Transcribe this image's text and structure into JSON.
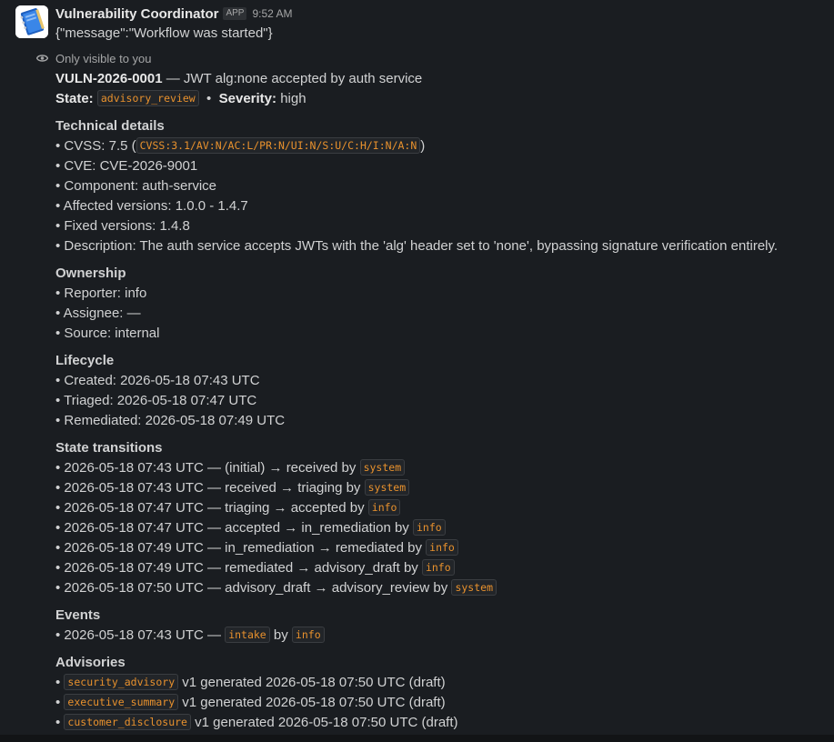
{
  "app": {
    "name": "Vulnerability Coordinator",
    "badge": "APP",
    "time": "9:52 AM"
  },
  "message_text": "{\"message\":\"Workflow was started\"}",
  "visibility": "Only visible to you",
  "vuln": {
    "id": "VULN-2026-0001",
    "title": " — JWT alg:none accepted by auth service",
    "state_label": "State:",
    "state": "advisory_review",
    "severity_label": "Severity:",
    "severity": "high"
  },
  "technical": {
    "heading": "Technical details",
    "cvss_prefix": "• CVSS: 7.5 (",
    "cvss_vector": "CVSS:3.1/AV:N/AC:L/PR:N/UI:N/S:U/C:H/I:N/A:N",
    "cvss_suffix": ")",
    "cve": "• CVE: CVE-2026-9001",
    "component": "• Component: auth-service",
    "affected": "• Affected versions: 1.0.0 - 1.4.7",
    "fixed": "• Fixed versions: 1.4.8",
    "description": "• Description: The auth service accepts JWTs with the 'alg' header set to 'none', bypassing signature verification entirely."
  },
  "ownership": {
    "heading": "Ownership",
    "reporter": "• Reporter: info",
    "assignee": "• Assignee: —",
    "source": "• Source: internal"
  },
  "lifecycle": {
    "heading": "Lifecycle",
    "created": "• Created: 2026-05-18 07:43 UTC",
    "triaged": "• Triaged: 2026-05-18 07:47 UTC",
    "remediated": "• Remediated: 2026-05-18 07:49 UTC"
  },
  "transitions": {
    "heading": "State transitions",
    "items": [
      {
        "text": "• 2026-05-18 07:43 UTC — (initial) → received by ",
        "actor": "system"
      },
      {
        "text": "• 2026-05-18 07:43 UTC — received → triaging by ",
        "actor": "system"
      },
      {
        "text": "• 2026-05-18 07:47 UTC — triaging → accepted by ",
        "actor": "info"
      },
      {
        "text": "• 2026-05-18 07:47 UTC — accepted → in_remediation by ",
        "actor": "info"
      },
      {
        "text": "• 2026-05-18 07:49 UTC — in_remediation → remediated by ",
        "actor": "info"
      },
      {
        "text": "• 2026-05-18 07:49 UTC — remediated → advisory_draft by ",
        "actor": "info"
      },
      {
        "text": "• 2026-05-18 07:50 UTC — advisory_draft → advisory_review by ",
        "actor": "system"
      }
    ]
  },
  "events": {
    "heading": "Events",
    "prefix": "• 2026-05-18 07:43 UTC — ",
    "event": "intake",
    "by": " by ",
    "actor": "info"
  },
  "advisories": {
    "heading": "Advisories",
    "items": [
      {
        "name": "security_advisory",
        "text": " v1 generated 2026-05-18 07:50 UTC (draft)"
      },
      {
        "name": "executive_summary",
        "text": " v1 generated 2026-05-18 07:50 UTC (draft)"
      },
      {
        "name": "customer_disclosure",
        "text": " v1 generated 2026-05-18 07:50 UTC (draft)"
      }
    ]
  },
  "colors": {
    "background": "#1a1d21",
    "code_text": "#e8912d",
    "text": "#d1d2d3"
  },
  "icons": {
    "avatar": "notebook-icon",
    "visibility": "eye-icon"
  }
}
